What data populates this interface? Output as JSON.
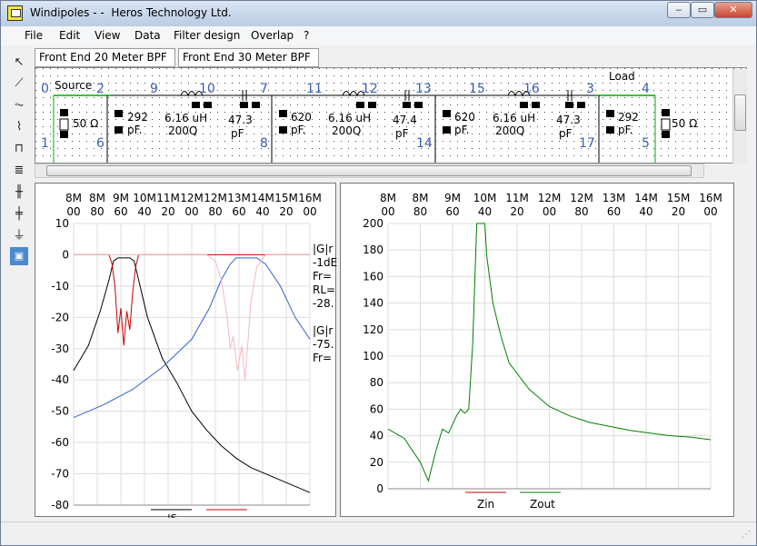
{
  "window": {
    "title": "Windipoles - -  Heros Technology Ltd.",
    "min": "‒",
    "max": "▭",
    "close": "✕"
  },
  "menu": [
    "File",
    "Edit",
    "View",
    "Data",
    "Filter design",
    "Overlap",
    "?"
  ],
  "tabs": [
    {
      "label": "Front End 20 Meter BPF"
    },
    {
      "label": "Front End 30 Meter BPF"
    }
  ],
  "toolbar": {
    "tools": [
      "pointer-tool",
      "wire-tool",
      "resistor-tool",
      "inductor-tool",
      "transformer-tool",
      "coil-tool",
      "capacitor-tool",
      "capacitor2-tool",
      "ground-tool",
      "image-tool"
    ]
  },
  "schematic": {
    "source_label": "Source",
    "load_label": "Load",
    "nodes": [
      "0",
      "2",
      "9",
      "10",
      "7",
      "11",
      "12",
      "13",
      "15",
      "16",
      "3",
      "4",
      "1",
      "6",
      "8",
      "14",
      "17",
      "5"
    ],
    "components": [
      {
        "name": "source-resistor",
        "value": "50 Ω"
      },
      {
        "name": "c-292-left",
        "value": "292",
        "unit": "pF."
      },
      {
        "name": "l-6-16-1",
        "value": "6.16 uH",
        "q": "200Q"
      },
      {
        "name": "c-47-3-1",
        "value": "47.3",
        "unit": "pF"
      },
      {
        "name": "c-620-1",
        "value": "620",
        "unit": "pF."
      },
      {
        "name": "l-6-16-2",
        "value": "6.16 uH",
        "q": "200Q"
      },
      {
        "name": "c-47-4",
        "value": "47.4",
        "unit": "pF"
      },
      {
        "name": "c-620-2",
        "value": "620",
        "unit": "pF."
      },
      {
        "name": "l-6-16-3",
        "value": "6.16 uH",
        "q": "200Q"
      },
      {
        "name": "c-47-3-2",
        "value": "47.3",
        "unit": "pF"
      },
      {
        "name": "c-292-right",
        "value": "292",
        "unit": "pF."
      },
      {
        "name": "load-resistor",
        "value": "50 Ω"
      }
    ]
  },
  "freq_ticks": [
    [
      "8M",
      "00"
    ],
    [
      "8M",
      "80"
    ],
    [
      "9M",
      "60"
    ],
    [
      "10M",
      "40"
    ],
    [
      "11M",
      "20"
    ],
    [
      "12M",
      "00"
    ],
    [
      "12M",
      "80"
    ],
    [
      "13M",
      "60"
    ],
    [
      "14M",
      "40"
    ],
    [
      "15M",
      "20"
    ],
    [
      "16M",
      "00"
    ]
  ],
  "left_plot": {
    "y_ticks": [
      "10",
      "0",
      "-10",
      "-20",
      "-30",
      "-40",
      "-50",
      "-60",
      "-70",
      "-80"
    ],
    "readout_lines": [
      "|G|r",
      "-1dE",
      "Fr=",
      "RL=",
      "-28.",
      "",
      "|G|r",
      "-75.",
      "Fr="
    ],
    "legend": [
      "|S",
      ""
    ],
    "colors": {
      "black": "#000000",
      "red": "#cc0000",
      "pink": "#f4b8c0",
      "blue": "#3060d0"
    }
  },
  "right_plot": {
    "y_ticks": [
      "200",
      "180",
      "160",
      "140",
      "120",
      "100",
      "80",
      "60",
      "40",
      "20",
      "0"
    ],
    "legend": [
      "Zin",
      "Zout"
    ],
    "colors": {
      "zin": "#cc0000",
      "zout": "#008000"
    }
  },
  "chart_data": [
    {
      "type": "line",
      "title": "",
      "xlabel": "",
      "ylabel": "",
      "xlim": [
        8.0,
        16.0
      ],
      "ylim": [
        -80,
        10
      ],
      "series": [
        {
          "values": [
            [
              8.0,
              -37
            ],
            [
              8.5,
              -29
            ],
            [
              8.9,
              -18
            ],
            [
              9.2,
              -8
            ],
            [
              9.35,
              -2
            ],
            [
              9.5,
              -1
            ],
            [
              9.9,
              -1
            ],
            [
              10.05,
              -2
            ],
            [
              10.2,
              -8
            ],
            [
              10.5,
              -20
            ],
            [
              11.0,
              -33
            ],
            [
              11.5,
              -41
            ],
            [
              12.0,
              -50
            ],
            [
              12.5,
              -56
            ],
            [
              13.0,
              -61
            ],
            [
              13.5,
              -65
            ],
            [
              14.0,
              -68
            ],
            [
              14.5,
              -70
            ],
            [
              15.0,
              -72
            ],
            [
              15.5,
              -74
            ],
            [
              16.0,
              -76
            ]
          ]
        },
        {
          "values": [
            [
              8.0,
              0
            ],
            [
              9.2,
              0
            ],
            [
              9.3,
              -3
            ],
            [
              9.4,
              -10
            ],
            [
              9.5,
              -25
            ],
            [
              9.6,
              -17
            ],
            [
              9.7,
              -29
            ],
            [
              9.8,
              -18
            ],
            [
              9.9,
              -24
            ],
            [
              10.0,
              -12
            ],
            [
              10.1,
              -4
            ],
            [
              10.2,
              0
            ],
            [
              16.0,
              0
            ]
          ]
        },
        {
          "values": [
            [
              8.0,
              -52
            ],
            [
              9.0,
              -48
            ],
            [
              10.0,
              -43
            ],
            [
              11.0,
              -36
            ],
            [
              12.0,
              -27
            ],
            [
              12.6,
              -17
            ],
            [
              13.0,
              -8
            ],
            [
              13.3,
              -3
            ],
            [
              13.5,
              -1
            ],
            [
              14.2,
              -1
            ],
            [
              14.5,
              -3
            ],
            [
              15.0,
              -10
            ],
            [
              15.5,
              -20
            ],
            [
              16.0,
              -27
            ]
          ]
        },
        {
          "values": [
            [
              8.0,
              0
            ],
            [
              12.5,
              0
            ],
            [
              12.8,
              -2
            ],
            [
              13.0,
              -8
            ],
            [
              13.2,
              -20
            ],
            [
              13.3,
              -30
            ],
            [
              13.4,
              -26
            ],
            [
              13.55,
              -37
            ],
            [
              13.7,
              -29
            ],
            [
              13.8,
              -40
            ],
            [
              13.9,
              -28
            ],
            [
              14.0,
              -15
            ],
            [
              14.2,
              -4
            ],
            [
              14.5,
              0
            ],
            [
              16.0,
              0
            ]
          ]
        }
      ]
    },
    {
      "type": "line",
      "title": "",
      "xlabel": "",
      "ylabel": "",
      "xlim": [
        8.0,
        16.0
      ],
      "ylim": [
        0,
        200
      ],
      "series": [
        {
          "name": "Zout",
          "values": [
            [
              8.0,
              45
            ],
            [
              8.4,
              38
            ],
            [
              8.8,
              20
            ],
            [
              9.0,
              6
            ],
            [
              9.2,
              30
            ],
            [
              9.35,
              45
            ],
            [
              9.5,
              42
            ],
            [
              9.7,
              55
            ],
            [
              9.8,
              60
            ],
            [
              9.9,
              57
            ],
            [
              10.0,
              60
            ],
            [
              10.1,
              110
            ],
            [
              10.2,
              200
            ],
            [
              10.4,
              200
            ],
            [
              10.45,
              175
            ],
            [
              10.6,
              140
            ],
            [
              10.8,
              115
            ],
            [
              11.0,
              95
            ],
            [
              11.5,
              75
            ],
            [
              12.0,
              62
            ],
            [
              12.5,
              55
            ],
            [
              13.0,
              50
            ],
            [
              13.5,
              47
            ],
            [
              14.0,
              44
            ],
            [
              14.5,
              42
            ],
            [
              15.0,
              40
            ],
            [
              15.5,
              39
            ],
            [
              16.0,
              37
            ]
          ]
        }
      ]
    }
  ]
}
